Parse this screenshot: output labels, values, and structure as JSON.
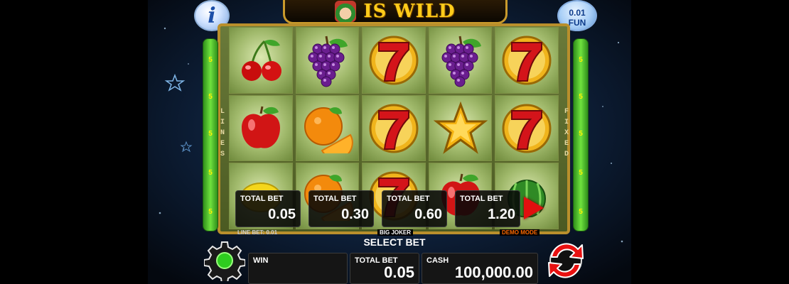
{
  "header": {
    "info_icon_glyph": "i",
    "title": "IS WILD",
    "fun_value": "0.01",
    "fun_label": "FUN"
  },
  "reels": [
    [
      "cherry",
      "apple",
      "lemon"
    ],
    [
      "grapes",
      "orange",
      "orange"
    ],
    [
      "seven",
      "seven",
      "seven"
    ],
    [
      "grapes",
      "star",
      "apple"
    ],
    [
      "seven",
      "seven",
      "watermelon"
    ]
  ],
  "lines": {
    "left_numbers": [
      "5",
      "5",
      "5",
      "5",
      "5"
    ],
    "right_numbers": [
      "5",
      "5",
      "5",
      "5",
      "5"
    ],
    "left_word": "LINES",
    "right_word": "FIXED"
  },
  "bet_options": [
    {
      "label": "TOTAL BET",
      "value": "0.05"
    },
    {
      "label": "TOTAL BET",
      "value": "0.30"
    },
    {
      "label": "TOTAL BET",
      "value": "0.60"
    },
    {
      "label": "TOTAL BET",
      "value": "1.20"
    }
  ],
  "status": {
    "line_bet": "LINE BET: 0.01",
    "game_name": "BIG JOKER",
    "mode": "DEMO MODE",
    "select_bet": "SELECT BET"
  },
  "panel": {
    "win_label": "WIN",
    "win_value": "",
    "total_bet_label": "TOTAL BET",
    "total_bet_value": "0.05",
    "cash_label": "CASH",
    "cash_value": "100,000.00"
  },
  "colors": {
    "accent_gold": "#c99a2c",
    "lines_green": "#6fe23e",
    "play_red": "#e10f0f",
    "demo_orange": "#ff6a00"
  }
}
